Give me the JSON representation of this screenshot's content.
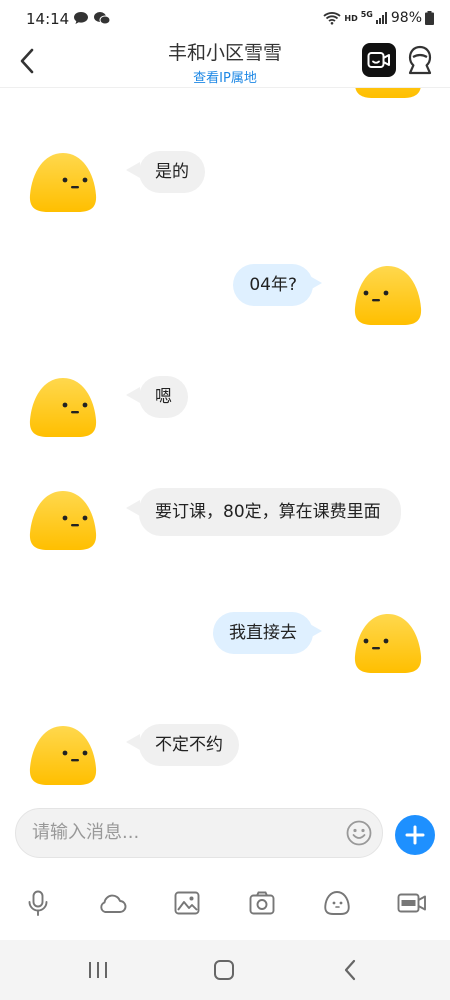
{
  "status_bar": {
    "time": "14:14",
    "battery": "98%",
    "network": "HD",
    "signal": "5G"
  },
  "header": {
    "title": "丰和小区雪雪",
    "subtitle": "查看IP属地"
  },
  "messages": [
    {
      "side": "in",
      "text": "是的"
    },
    {
      "side": "out",
      "text": "04年?"
    },
    {
      "side": "in",
      "text": "嗯"
    },
    {
      "side": "in",
      "text": "要订课，80定，算在课费里面"
    },
    {
      "side": "out",
      "text": "我直接去"
    },
    {
      "side": "in",
      "text": "不定不约"
    }
  ],
  "input": {
    "placeholder": "请输入消息..."
  },
  "toolbar": {
    "icons": [
      "mic-icon",
      "cloud-icon",
      "image-icon",
      "camera-icon",
      "sticker-icon",
      "gif-icon"
    ]
  },
  "colors": {
    "accent": "#1e90ff",
    "link": "#1e88e5",
    "incoming_bubble": "#f0f0f0",
    "outgoing_bubble": "#dff0ff",
    "avatar": "#ffcc1a"
  }
}
